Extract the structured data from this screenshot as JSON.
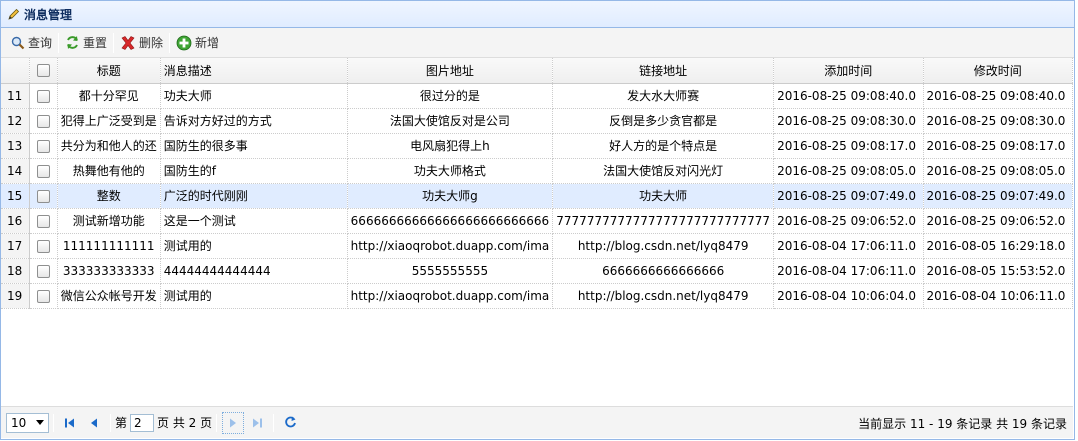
{
  "panel": {
    "title": "消息管理"
  },
  "toolbar": {
    "query_label": "查询",
    "reset_label": "重置",
    "delete_label": "删除",
    "add_label": "新增"
  },
  "columns": [
    "标题",
    "消息描述",
    "图片地址",
    "链接地址",
    "添加时间",
    "修改时间"
  ],
  "rows": [
    {
      "num": "11",
      "title": "都十分罕见",
      "desc": "功夫大师",
      "img": "很过分的是",
      "link": "发大水大师赛",
      "added": "2016-08-25 09:08:40.0",
      "modified": "2016-08-25 09:08:40.0"
    },
    {
      "num": "12",
      "title": "犯得上广泛受到是",
      "desc": "告诉对方好过的方式",
      "img": "法国大使馆反对是公司",
      "link": "反倒是多少贪官都是",
      "added": "2016-08-25 09:08:30.0",
      "modified": "2016-08-25 09:08:30.0"
    },
    {
      "num": "13",
      "title": "共分为和他人的还",
      "desc": "国防生的很多事",
      "img": "电风扇犯得上h",
      "link": "好人方的是个特点是",
      "added": "2016-08-25 09:08:17.0",
      "modified": "2016-08-25 09:08:17.0"
    },
    {
      "num": "14",
      "title": "热舞他有他的",
      "desc": "国防生的f",
      "img": "功夫大师格式",
      "link": "法国大使馆反对闪光灯",
      "added": "2016-08-25 09:08:05.0",
      "modified": "2016-08-25 09:08:05.0"
    },
    {
      "num": "15",
      "title": "整数",
      "desc": "广泛的时代刚刚",
      "img": "功夫大师g",
      "link": "功夫大师",
      "added": "2016-08-25 09:07:49.0",
      "modified": "2016-08-25 09:07:49.0"
    },
    {
      "num": "16",
      "title": "测试新增功能",
      "desc": "这是一个测试",
      "img": "66666666666666666666666666",
      "link": "7777777777777777777777777777",
      "added": "2016-08-25 09:06:52.0",
      "modified": "2016-08-25 09:06:52.0"
    },
    {
      "num": "17",
      "title": "111111111111",
      "desc": "测试用的",
      "img": "http://xiaoqrobot.duapp.com/ima",
      "link": "http://blog.csdn.net/lyq8479",
      "added": "2016-08-04 17:06:11.0",
      "modified": "2016-08-05 16:29:18.0"
    },
    {
      "num": "18",
      "title": "333333333333",
      "desc": "44444444444444",
      "img": "5555555555",
      "link": "6666666666666666",
      "added": "2016-08-04 17:06:11.0",
      "modified": "2016-08-05 15:53:52.0"
    },
    {
      "num": "19",
      "title": "微信公众帐号开发",
      "desc": "测试用的",
      "img": "http://xiaoqrobot.duapp.com/ima",
      "link": "http://blog.csdn.net/lyq8479",
      "added": "2016-08-04 10:06:04.0",
      "modified": "2016-08-04 10:06:11.0"
    }
  ],
  "selected_row": "15",
  "pager": {
    "page_size": "10",
    "page_prefix": "第",
    "page_value": "2",
    "page_suffix": "页 共 2 页",
    "info": "当前显示 11 - 19 条记录 共 19 条记录"
  }
}
